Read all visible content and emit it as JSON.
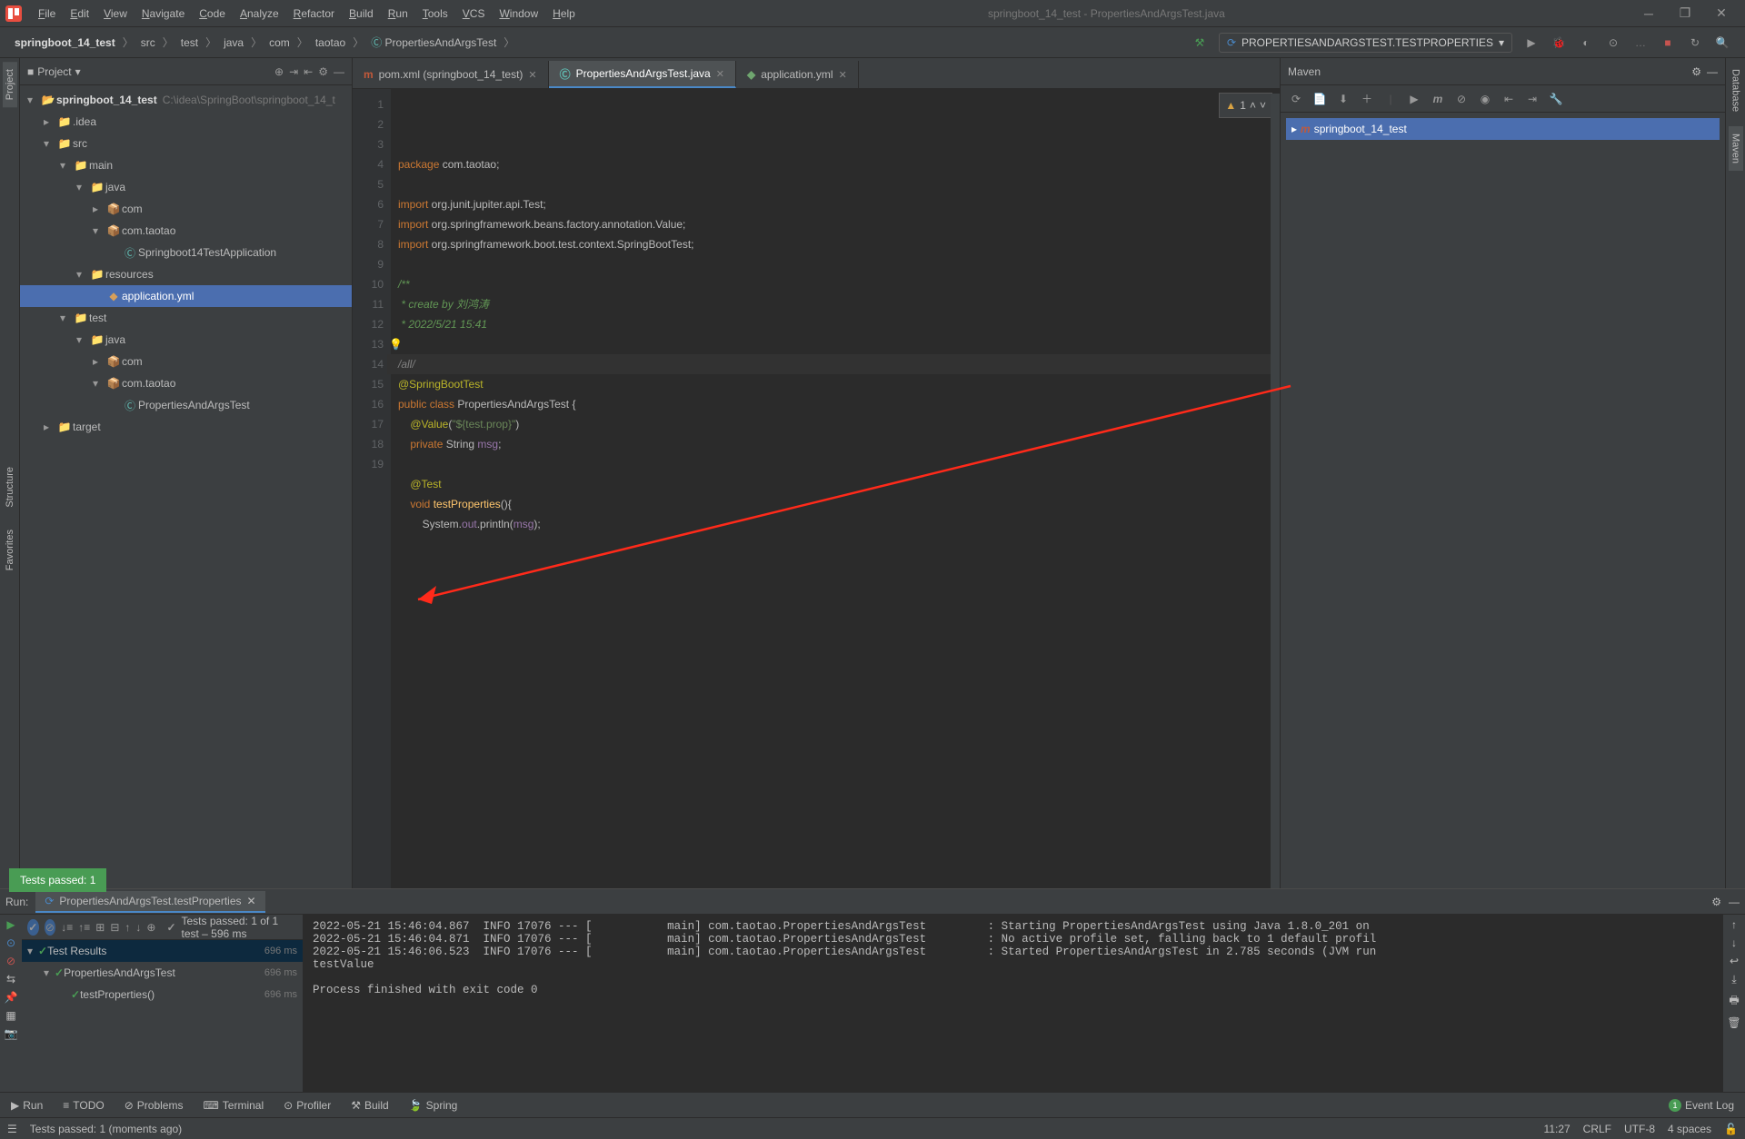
{
  "window": {
    "title": "springboot_14_test - PropertiesAndArgsTest.java"
  },
  "menu": [
    "File",
    "Edit",
    "View",
    "Navigate",
    "Code",
    "Analyze",
    "Refactor",
    "Build",
    "Run",
    "Tools",
    "VCS",
    "Window",
    "Help"
  ],
  "breadcrumb": {
    "root": "springboot_14_test",
    "parts": [
      "src",
      "test",
      "java",
      "com",
      "taotao",
      "PropertiesAndArgsTest"
    ]
  },
  "run_config": "PROPERTIESANDARGSTEST.TESTPROPERTIES",
  "project": {
    "title": "Project",
    "root": {
      "name": "springboot_14_test",
      "path": "C:\\idea\\SpringBoot\\springboot_14_t"
    },
    "nodes": [
      {
        "indent": 1,
        "arrow": "▸",
        "icon": "📁",
        "cls": "fold-gray",
        "label": ".idea"
      },
      {
        "indent": 1,
        "arrow": "▾",
        "icon": "📁",
        "cls": "fold-blue",
        "label": "src"
      },
      {
        "indent": 2,
        "arrow": "▾",
        "icon": "📁",
        "cls": "fold-blue",
        "label": "main"
      },
      {
        "indent": 3,
        "arrow": "▾",
        "icon": "📁",
        "cls": "fold-blue",
        "label": "java"
      },
      {
        "indent": 4,
        "arrow": "▸",
        "icon": "📦",
        "cls": "fold-gray",
        "label": "com"
      },
      {
        "indent": 4,
        "arrow": "▾",
        "icon": "📦",
        "cls": "fold-gray",
        "label": "com.taotao"
      },
      {
        "indent": 5,
        "arrow": "",
        "icon": "Ⓒ",
        "cls": "file-teal",
        "label": "Springboot14TestApplication"
      },
      {
        "indent": 3,
        "arrow": "▾",
        "icon": "📁",
        "cls": "fold-orange",
        "label": "resources"
      },
      {
        "indent": 4,
        "arrow": "",
        "icon": "◆",
        "cls": "file-orange",
        "label": "application.yml",
        "selected": true
      },
      {
        "indent": 2,
        "arrow": "▾",
        "icon": "📁",
        "cls": "fold-gray",
        "label": "test"
      },
      {
        "indent": 3,
        "arrow": "▾",
        "icon": "📁",
        "cls": "fold-teal",
        "label": "java"
      },
      {
        "indent": 4,
        "arrow": "▸",
        "icon": "📦",
        "cls": "fold-gray",
        "label": "com"
      },
      {
        "indent": 4,
        "arrow": "▾",
        "icon": "📦",
        "cls": "fold-gray",
        "label": "com.taotao"
      },
      {
        "indent": 5,
        "arrow": "",
        "icon": "Ⓒ",
        "cls": "file-teal",
        "label": "PropertiesAndArgsTest"
      },
      {
        "indent": 1,
        "arrow": "▸",
        "icon": "📁",
        "cls": "fold-orange",
        "label": "target"
      }
    ]
  },
  "tabs": [
    {
      "icon": "m",
      "iconColor": "#c2593a",
      "label": "pom.xml (springboot_14_test)",
      "active": false
    },
    {
      "icon": "Ⓒ",
      "iconColor": "#5fb8af",
      "label": "PropertiesAndArgsTest.java",
      "active": true
    },
    {
      "icon": "◆",
      "iconColor": "#6fa66f",
      "label": "application.yml",
      "active": false
    }
  ],
  "inspection": {
    "warnings": "1"
  },
  "code": {
    "lines": [
      {
        "n": 1,
        "html": "<span class='kw'>package</span> com.taotao;"
      },
      {
        "n": 2,
        "html": ""
      },
      {
        "n": 3,
        "html": "<span class='kw'>import</span> org.junit.jupiter.api.Test;"
      },
      {
        "n": 4,
        "html": "<span class='kw'>import</span> org.springframework.beans.factory.annotation.Value;"
      },
      {
        "n": 5,
        "html": "<span class='kw'>import</span> org.springframework.boot.test.context.SpringBootTest;"
      },
      {
        "n": 6,
        "html": ""
      },
      {
        "n": 7,
        "html": "<span class='cmt-star'>/**</span>"
      },
      {
        "n": 8,
        "html": "<span class='cmt-star'> * create by 刘鸿涛</span>"
      },
      {
        "n": 9,
        "html": "<span class='cmt-star'> * 2022/5/21 15:41</span>"
      },
      {
        "n": 10,
        "html": "",
        "bulb": true
      },
      {
        "n": 11,
        "html": "<span class='cmt'>/all/</span>",
        "hl": true
      },
      {
        "n": 12,
        "html": "<span class='ann'>@SpringBootTest</span>",
        "mark": "leaf"
      },
      {
        "n": 13,
        "html": "<span class='kw'>public</span> <span class='kw'>class</span> PropertiesAndArgsTest {",
        "mark": "run"
      },
      {
        "n": 14,
        "html": "    <span class='ann'>@Value</span>(<span class='str'>\"${test.prop}\"</span>)"
      },
      {
        "n": 15,
        "html": "    <span class='kw'>private</span> String <span class='fld'>msg</span>;"
      },
      {
        "n": 16,
        "html": ""
      },
      {
        "n": 17,
        "html": "    <span class='ann'>@Test</span>"
      },
      {
        "n": 18,
        "html": "    <span class='kw'>void</span> <span class='fn'>testProperties</span>(){",
        "mark": "run"
      },
      {
        "n": 19,
        "html": "        System.<span class='fld'>out</span>.println(<span class='fld'>msg</span>);"
      }
    ]
  },
  "maven": {
    "title": "Maven",
    "project": "springboot_14_test"
  },
  "run": {
    "label": "Run:",
    "tab": "PropertiesAndArgsTest.testProperties",
    "header": "Tests passed: 1 of 1 test – 596 ms",
    "tree": [
      {
        "indent": 0,
        "label": "Test Results",
        "time": "696 ms",
        "sel": true
      },
      {
        "indent": 1,
        "label": "PropertiesAndArgsTest",
        "time": "696 ms"
      },
      {
        "indent": 2,
        "label": "testProperties()",
        "time": "696 ms"
      }
    ],
    "console": "2022-05-21 15:46:04.867  INFO 17076 --- [           main] com.taotao.PropertiesAndArgsTest         : Starting PropertiesAndArgsTest using Java 1.8.0_201 on\n2022-05-21 15:46:04.871  INFO 17076 --- [           main] com.taotao.PropertiesAndArgsTest         : No active profile set, falling back to 1 default profil\n2022-05-21 15:46:06.523  INFO 17076 --- [           main] com.taotao.PropertiesAndArgsTest         : Started PropertiesAndArgsTest in 2.785 seconds (JVM run\ntestValue\n\nProcess finished with exit code 0"
  },
  "toast": "Tests passed: 1",
  "bottom": [
    "Run",
    "TODO",
    "Problems",
    "Terminal",
    "Profiler",
    "Build",
    "Spring"
  ],
  "eventlog": "Event Log",
  "status": {
    "msg": "Tests passed: 1 (moments ago)",
    "pos": "11:27",
    "eol": "CRLF",
    "enc": "UTF-8",
    "indent": "4 spaces",
    "branch": ""
  },
  "left_tabs": [
    "Project",
    "Structure",
    "Favorites"
  ],
  "right_tabs": [
    "Database",
    "Maven"
  ]
}
